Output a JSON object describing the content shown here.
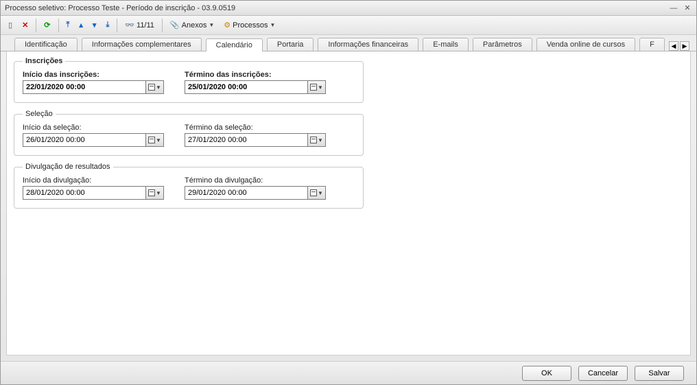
{
  "window": {
    "title": "Processo seletivo: Processo Teste - Período de inscrição - 03.9.0519"
  },
  "toolbar": {
    "counter": "11/11",
    "anexos": "Anexos",
    "processos": "Processos"
  },
  "tabs": {
    "identificacao": "Identificação",
    "info_complementares": "Informações complementares",
    "calendario": "Calendário",
    "portaria": "Portaria",
    "info_financeiras": "Informações financeiras",
    "emails": "E-mails",
    "parametros": "Parâmetros",
    "venda": "Venda online de cursos",
    "overflow": "F"
  },
  "groups": {
    "inscricoes": {
      "legend": "Inscrições",
      "inicio_label": "Início das inscrições:",
      "inicio_value": "22/01/2020 00:00",
      "termino_label": "Término das inscrições:",
      "termino_value": "25/01/2020 00:00"
    },
    "selecao": {
      "legend": "Seleção",
      "inicio_label": "Início da seleção:",
      "inicio_value": "26/01/2020 00:00",
      "termino_label": "Término da seleção:",
      "termino_value": "27/01/2020 00:00"
    },
    "divulgacao": {
      "legend": "Divulgação de resultados",
      "inicio_label": "Início da divulgação:",
      "inicio_value": "28/01/2020 00:00",
      "termino_label": "Término da divulgação:",
      "termino_value": "29/01/2020 00:00"
    }
  },
  "footer": {
    "ok": "OK",
    "cancelar": "Cancelar",
    "salvar": "Salvar"
  }
}
